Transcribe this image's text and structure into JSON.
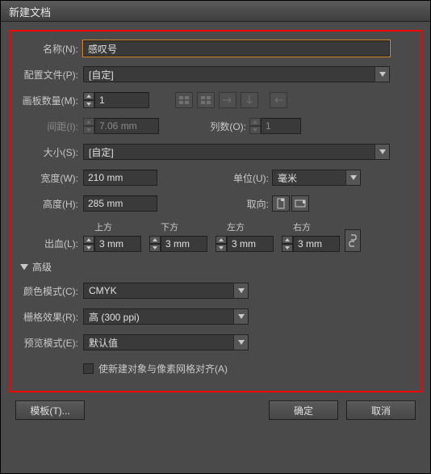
{
  "window": {
    "title": "新建文档"
  },
  "name": {
    "label": "名称(N):",
    "value": "感叹号"
  },
  "profile": {
    "label": "配置文件(P):",
    "value": "[自定]"
  },
  "artboards": {
    "label": "画板数量(M):",
    "value": "1"
  },
  "spacing": {
    "label": "间距(I):",
    "value": "7.06 mm"
  },
  "columns": {
    "label": "列数(O):",
    "value": "1"
  },
  "size": {
    "label": "大小(S):",
    "value": "[自定]"
  },
  "width": {
    "label": "宽度(W):",
    "value": "210 mm"
  },
  "height": {
    "label": "高度(H):",
    "value": "285 mm"
  },
  "units": {
    "label": "单位(U):",
    "value": "毫米"
  },
  "orient": {
    "label": "取向:"
  },
  "bleed": {
    "label": "出血(L):",
    "top": {
      "label": "上方",
      "value": "3 mm"
    },
    "bottom": {
      "label": "下方",
      "value": "3 mm"
    },
    "left": {
      "label": "左方",
      "value": "3 mm"
    },
    "right": {
      "label": "右方",
      "value": "3 mm"
    }
  },
  "advanced": {
    "label": "高级"
  },
  "colormode": {
    "label": "颜色模式(C):",
    "value": "CMYK"
  },
  "raster": {
    "label": "栅格效果(R):",
    "value": "高 (300 ppi)"
  },
  "preview": {
    "label": "预览模式(E):",
    "value": "默认值"
  },
  "align": {
    "label": "使新建对象与像素网格对齐(A)"
  },
  "buttons": {
    "templates": "模板(T)...",
    "ok": "确定",
    "cancel": "取消"
  }
}
